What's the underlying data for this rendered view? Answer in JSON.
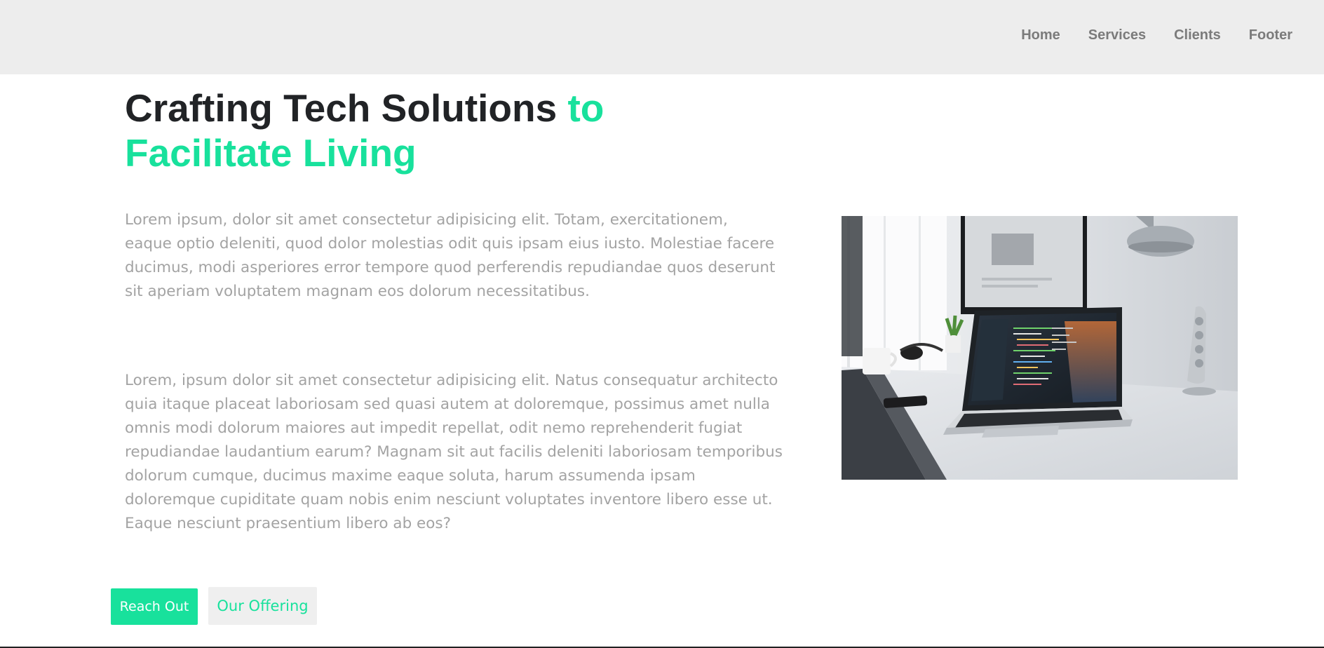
{
  "nav": {
    "items": [
      {
        "label": "Home"
      },
      {
        "label": "Services"
      },
      {
        "label": "Clients"
      },
      {
        "label": "Footer"
      }
    ]
  },
  "hero": {
    "title_dark": "Crafting Tech Solutions ",
    "title_accent": "to Facilitate Living",
    "paragraph_1": "Lorem ipsum, dolor sit amet consectetur adipisicing elit. Totam, exercitationem, eaque optio deleniti, quod dolor molestias odit quis ipsam eius iusto. Molestiae facere ducimus, modi asperiores error tempore quod perferendis repudiandae quos deserunt sit aperiam voluptatem magnam eos dolorum necessitatibus.",
    "paragraph_2": "Lorem, ipsum dolor sit amet consectetur adipisicing elit. Natus consequatur architecto quia itaque placeat laboriosam sed quasi autem at doloremque, possimus amet nulla omnis modi dolorum maiores aut impedit repellat, odit nemo reprehenderit fugiat repudiandae laudantium earum? Magnam sit aut facilis deleniti laboriosam temporibus dolorum cumque, ducimus maxime eaque soluta, harum assumenda ipsam doloremque cupiditate quam nobis enim nesciunt voluptates inventore libero esse ut. Eaque nesciunt praesentium libero ab eos?",
    "primary_button": "Reach Out",
    "secondary_button": "Our Offering"
  },
  "colors": {
    "accent": "#18e19c",
    "navbar_bg": "#ededed",
    "heading": "#212326",
    "body_text": "#a3a3a3"
  }
}
